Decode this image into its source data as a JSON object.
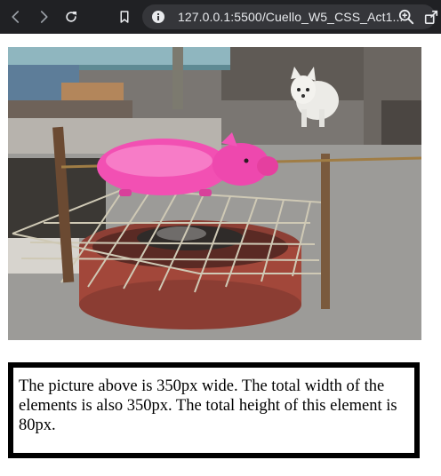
{
  "browser": {
    "url": "127.0.0.1:5500/Cuello_W5_CSS_Act1...",
    "icons": {
      "back": "back-arrow-icon",
      "forward": "forward-arrow-icon",
      "reload": "reload-icon",
      "bookmark": "bookmark-icon",
      "site_info": "info-icon",
      "zoom": "zoom-in-icon",
      "share": "share-icon"
    },
    "colors": {
      "toolbar": "#202124",
      "omnibox": "#35363a",
      "icon": "#9aa0a6",
      "text": "#e8eaed"
    }
  },
  "page": {
    "image": {
      "subject": "pink-piggy-bank-on-grill-photo"
    },
    "caption": "The picture above is 350px wide. The total width of the elements is also 350px. The total height of this element is 80px.",
    "colors": {
      "border": "#000000",
      "background": "#ffffff"
    }
  }
}
